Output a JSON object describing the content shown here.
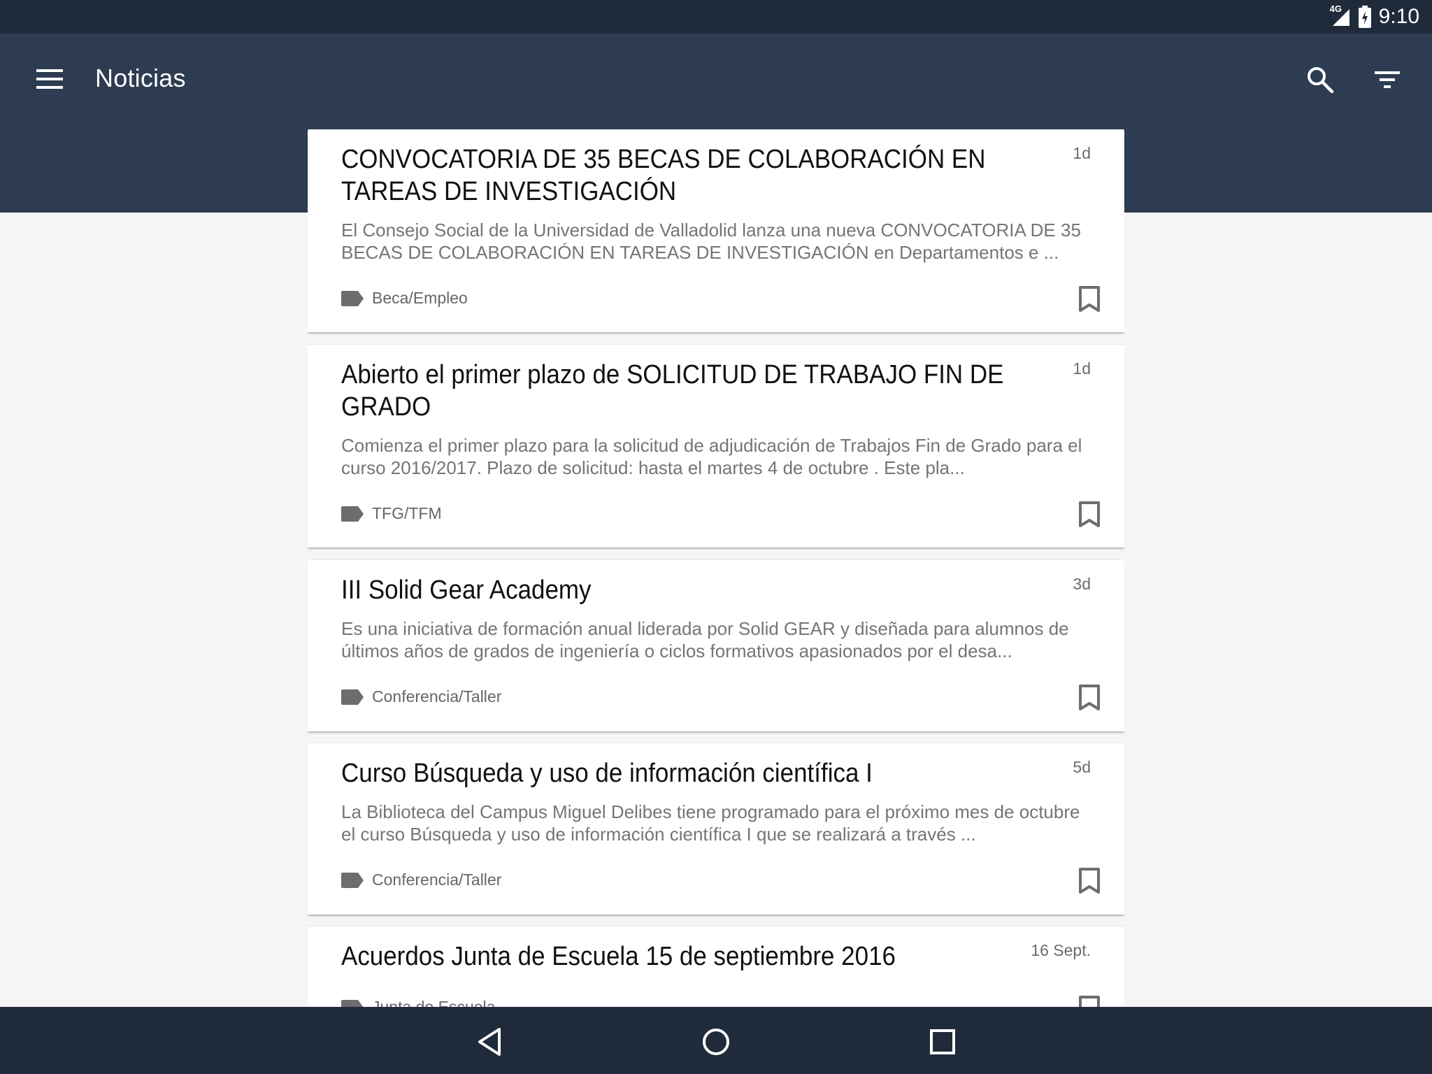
{
  "status_bar": {
    "network": "4G",
    "time": "9:10"
  },
  "toolbar": {
    "title": "Noticias"
  },
  "icons": {
    "menu": "menu-icon",
    "search": "search-icon",
    "filter": "filter-icon",
    "tag": "label-icon",
    "bookmark": "bookmark-outline-icon",
    "back": "back-icon",
    "home": "home-icon",
    "recents": "recents-icon"
  },
  "colors": {
    "status_bar": "#1f2b3a",
    "app_bar": "#2d3c50",
    "background": "#f5f5f5"
  },
  "news": [
    {
      "title": "CONVOCATORIA DE 35 BECAS DE COLABORACIÓN EN TAREAS DE INVESTIGACIÓN",
      "time": "1d",
      "description": "El Consejo Social de la Universidad de Valladolid lanza una nueva CONVOCATORIA DE 35 BECAS DE COLABORACIÓN EN TAREAS DE INVESTIGACIÓN en Departamentos e ...",
      "tag": "Beca/Empleo"
    },
    {
      "title": "Abierto el primer plazo de SOLICITUD DE TRABAJO FIN DE GRADO",
      "time": "1d",
      "description": "Comienza el primer plazo para la solicitud de adjudicación de Trabajos Fin de Grado para el curso 2016/2017.  Plazo de solicitud: hasta el martes 4 de octubre .  Este pla...",
      "tag": "TFG/TFM"
    },
    {
      "title": "III Solid Gear Academy",
      "time": "3d",
      "description": "Es una iniciativa de formación anual liderada por Solid GEAR y diseñada para alumnos de últimos años de grados de ingeniería o ciclos formativos apasionados por el desa...",
      "tag": "Conferencia/Taller"
    },
    {
      "title": "Curso Búsqueda y uso de información científica I",
      "time": "5d",
      "description": "La Biblioteca del Campus Miguel Delibes  tiene programado para el próximo mes de octubre el curso Búsqueda y uso de información científica I que se realizará a través ...",
      "tag": "Conferencia/Taller"
    },
    {
      "title": "Acuerdos Junta de Escuela 15 de septiembre 2016",
      "time": "16 Sept.",
      "description": "",
      "tag": "Junta de Escuela"
    }
  ]
}
